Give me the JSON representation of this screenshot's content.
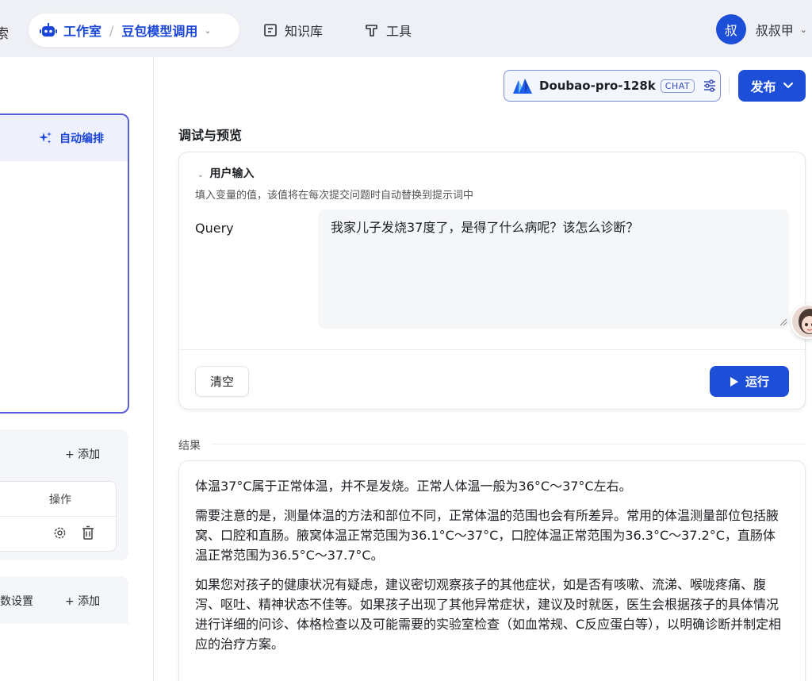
{
  "nav": {
    "left_fragment": "索",
    "workspace_label": "工作室",
    "separator": "/",
    "project_label": "豆包模型调用",
    "knowledge_label": "知识库",
    "tools_label": "工具",
    "user_avatar_char": "叔",
    "user_name": "叔叔甲"
  },
  "toolbar": {
    "model_name": "Doubao-pro-128k",
    "model_badge": "CHAT",
    "publish_label": "发布"
  },
  "left": {
    "auto_arrange_label": "自动编排",
    "add_label_1": "+ 添加",
    "ops_header": "操作",
    "section2_label": "数设置",
    "add_label_2": "+ 添加"
  },
  "debug": {
    "title": "调试与预览",
    "user_input_label": "用户输入",
    "hint": "填入变量的值，该值将在每次提交问题时自动替换到提示词中",
    "query_label": "Query",
    "query_value": "我家儿子发烧37度了，是得了什么病呢？该怎么诊断？",
    "clear_label": "清空",
    "run_label": "运行"
  },
  "result": {
    "title": "结果",
    "paragraphs": [
      "体温37°C属于正常体温，并不是发烧。正常人体温一般为36°C～37°C左右。",
      "需要注意的是，测量体温的方法和部位不同，正常体温的范围也会有所差异。常用的体温测量部位包括腋窝、口腔和直肠。腋窝体温正常范围为36.1°C～37°C，口腔体温正常范围为36.3°C～37.2°C，直肠体温正常范围为36.5°C～37.7°C。",
      "如果您对孩子的健康状况有疑虑，建议密切观察孩子的其他症状，如是否有咳嗽、流涕、喉咙疼痛、腹泻、呕吐、精神状态不佳等。如果孩子出现了其他异常症状，建议及时就医，医生会根据孩子的具体情况进行详细的问诊、体格检查以及可能需要的实验室检查（如血常规、C反应蛋白等），以明确诊断并制定相应的治疗方案。"
    ]
  },
  "colors": {
    "brand_blue": "#1d4ed8",
    "prompt_border": "#5b5fd9"
  }
}
